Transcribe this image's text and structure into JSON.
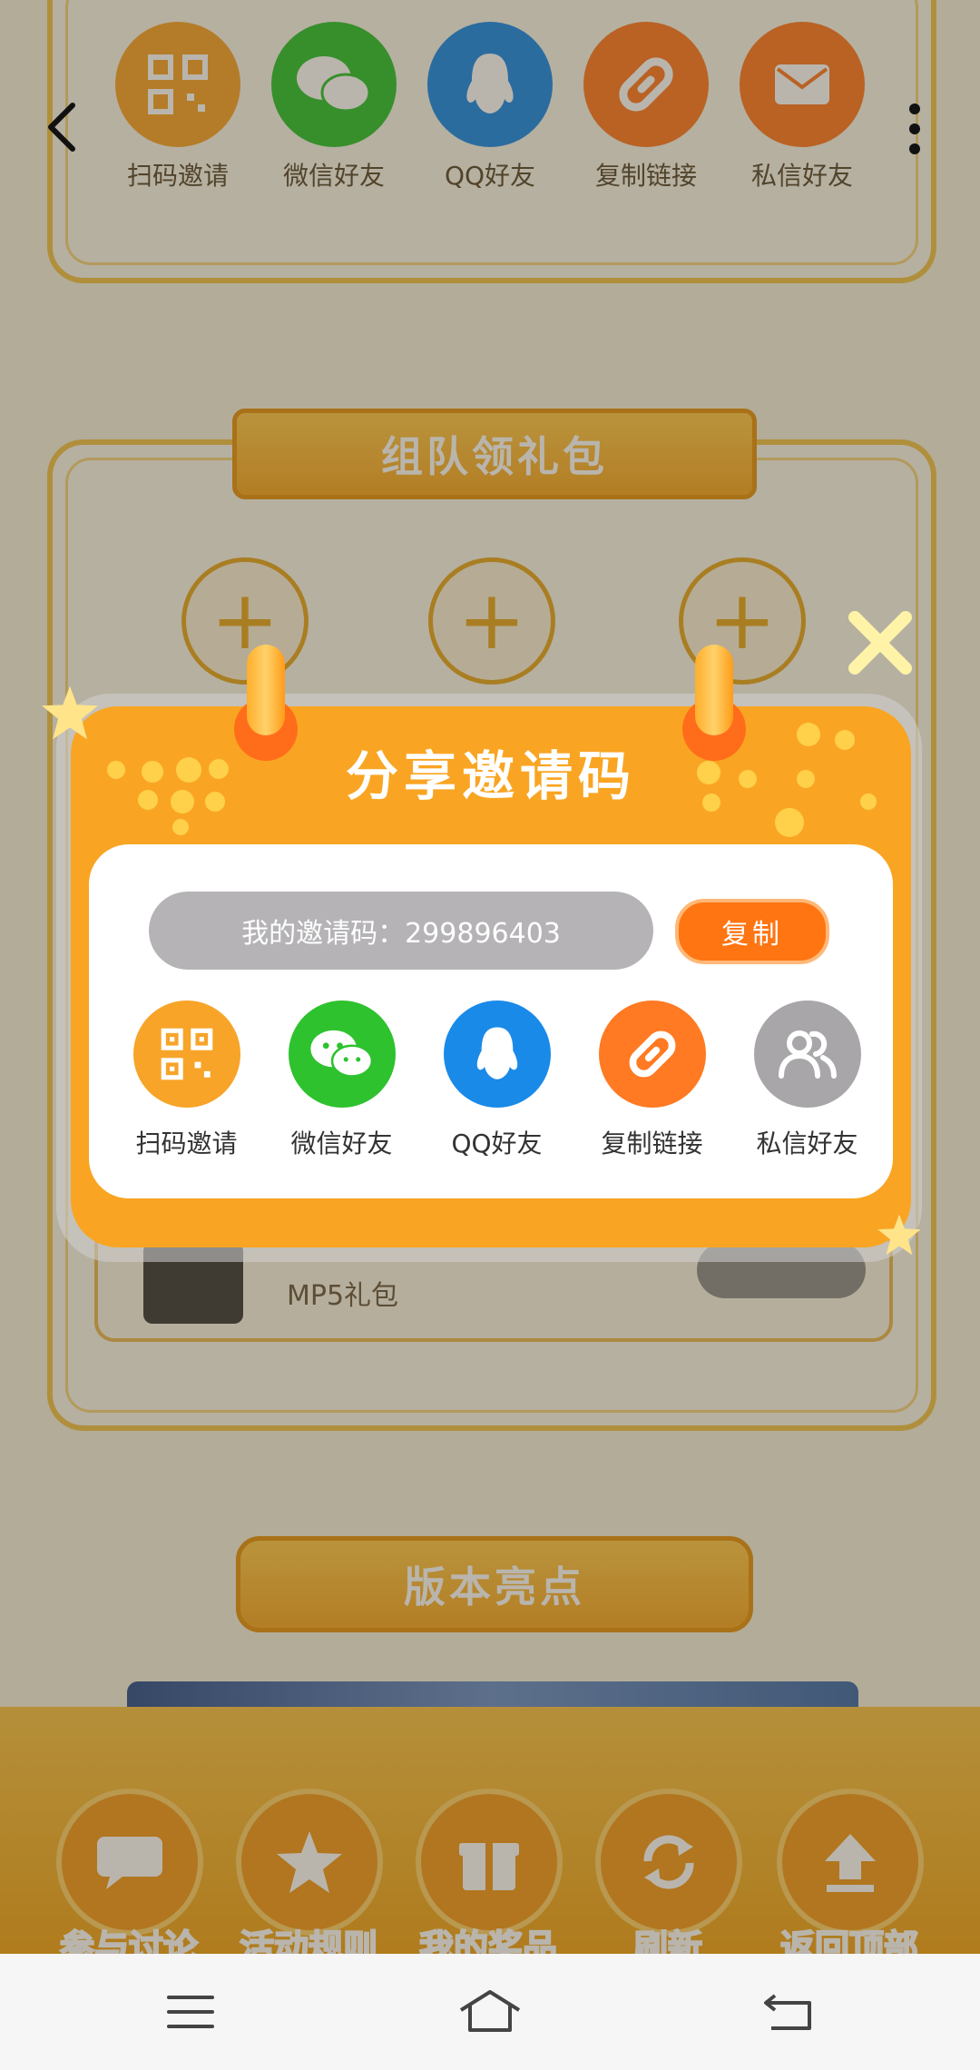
{
  "page": {
    "top_share": [
      "扫码邀请",
      "微信好友",
      "QQ好友",
      "复制链接",
      "私信好友"
    ],
    "team_title": "组队领礼包",
    "gift_name": "MP5礼包",
    "version_title": "版本亮点",
    "bottom_nav": [
      "参与讨论",
      "活动规则",
      "我的奖品",
      "刷新",
      "返回顶部"
    ]
  },
  "modal": {
    "title": "分享邀请码",
    "code_text": "我的邀请码：299896403",
    "copy_label": "复制",
    "share": [
      "扫码邀请",
      "微信好友",
      "QQ好友",
      "复制链接",
      "私信好友"
    ]
  },
  "colors": {
    "accent": "#f9a523",
    "wechat": "#2ec22e",
    "qq": "#1a8ae8",
    "link": "#ff7a22",
    "grey": "#a8a6a9"
  }
}
